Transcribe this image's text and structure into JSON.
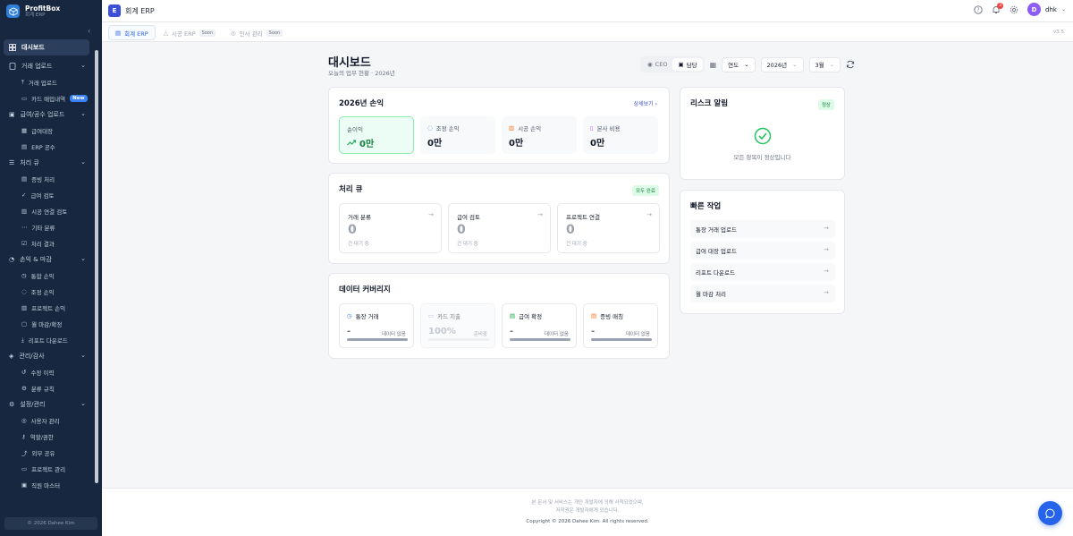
{
  "brand": {
    "title": "ProfitBox",
    "subtitle": "회계 ERP"
  },
  "sidebar": {
    "items": [
      {
        "label": "대시보드",
        "icon": "grid-icon",
        "active": true
      },
      {
        "label": "거래 업로드",
        "icon": "doc-icon",
        "children": [
          {
            "label": "거래 업로드",
            "icon": "upload-icon"
          },
          {
            "label": "카드 매입내역",
            "icon": "card-icon",
            "badge": "New"
          }
        ]
      },
      {
        "label": "급여/공수 업로드",
        "icon": "wallet-icon",
        "children": [
          {
            "label": "급여대장",
            "icon": "table-icon"
          },
          {
            "label": "ERP 공수",
            "icon": "file-icon"
          }
        ]
      },
      {
        "label": "처리 큐",
        "icon": "list-icon",
        "children": [
          {
            "label": "증빙 처리",
            "icon": "doc-icon"
          },
          {
            "label": "급여 검토",
            "icon": "user-check-icon"
          },
          {
            "label": "시공 연결 검토",
            "icon": "building-icon"
          },
          {
            "label": "기타 분류",
            "icon": "dots-icon"
          },
          {
            "label": "처리 결과",
            "icon": "check-square-icon"
          }
        ]
      },
      {
        "label": "손익 & 마감",
        "icon": "pie-icon",
        "children": [
          {
            "label": "통합 손익",
            "icon": "clock-icon"
          },
          {
            "label": "조정 손익",
            "icon": "user-icon"
          },
          {
            "label": "프로젝트 손익",
            "icon": "building-icon"
          },
          {
            "label": "월 마감/확정",
            "icon": "lock-icon"
          },
          {
            "label": "리포트 다운로드",
            "icon": "download-icon"
          }
        ]
      },
      {
        "label": "관리/감사",
        "icon": "shield-icon",
        "children": [
          {
            "label": "수정 이력",
            "icon": "history-icon"
          },
          {
            "label": "분류 규칙",
            "icon": "rule-icon"
          }
        ]
      },
      {
        "label": "설정/관리",
        "icon": "gear-icon",
        "children": [
          {
            "label": "사용자 관리",
            "icon": "users-icon"
          },
          {
            "label": "역할/권한",
            "icon": "key-icon"
          },
          {
            "label": "외부 공유",
            "icon": "share-icon"
          },
          {
            "label": "프로젝트 관리",
            "icon": "folder-icon"
          },
          {
            "label": "직원 마스터",
            "icon": "id-icon"
          }
        ]
      }
    ],
    "footer": "© 2026 Dahee Kim"
  },
  "topbar": {
    "app_badge": "E",
    "app_title": "회계 ERP",
    "notif_count": "3",
    "avatar_initial": "D",
    "user": "dhk"
  },
  "tabs": [
    {
      "label": "회계 ERP",
      "active": true
    },
    {
      "label": "시공 ERP",
      "badge": "Soon"
    },
    {
      "label": "인사 관리",
      "badge": "Soon"
    }
  ],
  "version": "v3.5",
  "page": {
    "title": "대시보드",
    "subtitle": "오늘의 업무 현황 · 2026년"
  },
  "controls": {
    "ceo": "CEO",
    "staff": "담당",
    "period": "연도",
    "year": "2026년",
    "month": "3월"
  },
  "pnl": {
    "title": "2026년 손익",
    "link": "상세보기",
    "tiles": [
      {
        "label": "순이익",
        "value": "0만"
      },
      {
        "label": "조정 손익",
        "value": "0만"
      },
      {
        "label": "시공 손익",
        "value": "0만"
      },
      {
        "label": "본사 비용",
        "value": "0만"
      }
    ]
  },
  "queue": {
    "title": "처리 큐",
    "badge": "모두 완료",
    "tiles": [
      {
        "label": "거래 분류",
        "count": "0",
        "sub": "건 대기 중"
      },
      {
        "label": "급여 검토",
        "count": "0",
        "sub": "건 대기 중"
      },
      {
        "label": "프로젝트 연결",
        "count": "0",
        "sub": "건 대기 중"
      }
    ]
  },
  "coverage": {
    "title": "데이터 커버리지",
    "tiles": [
      {
        "label": "통장 거래",
        "value": "-",
        "status": "데이터 없음",
        "icon": "clock-icon",
        "fill": 1.0
      },
      {
        "label": "카드 지출",
        "value": "100%",
        "status": "준비중",
        "icon": "card-icon",
        "fill": 1.0
      },
      {
        "label": "급여 확정",
        "value": "-",
        "status": "데이터 없음",
        "icon": "sheet-icon",
        "fill": 1.0
      },
      {
        "label": "증빙 매칭",
        "value": "-",
        "status": "데이터 없음",
        "icon": "doc-icon",
        "fill": 1.0
      }
    ]
  },
  "risk": {
    "title": "리스크 알림",
    "badge": "정상",
    "message": "모든 항목이 정상입니다"
  },
  "quick": {
    "title": "빠른 작업",
    "items": [
      "통장 거래 업로드",
      "급여 대장 업로드",
      "리포트 다운로드",
      "월 마감 처리"
    ]
  },
  "footer": {
    "line1": "본 문서 및 서비스는 개인 개발자에 의해 사적되었으며,",
    "line2": "저작권은 개발자에게 있습니다.",
    "line3": "Copyright © 2026 Dahee Kim. All rights reserved."
  },
  "colors": {
    "sidebar": "#16273f",
    "accent": "#3b4fd8",
    "success": "#16a34a",
    "avatar": "#8b5cf6"
  }
}
